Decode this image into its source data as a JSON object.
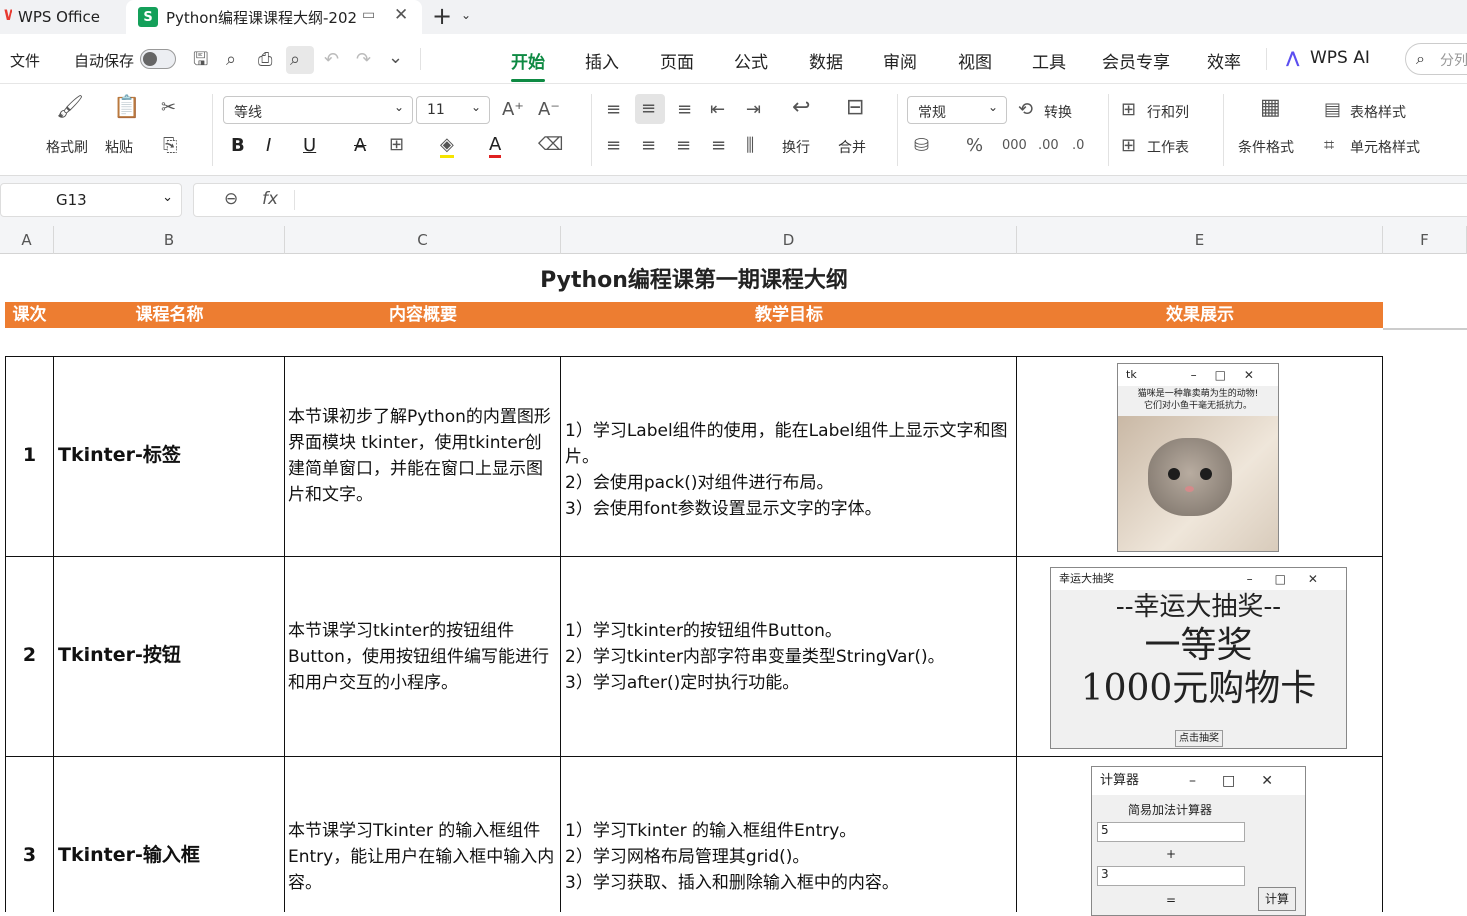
{
  "tabs": {
    "home_label": "WPS Office",
    "doc_label": "Python编程课课程大纲-202",
    "add_glyph": "+"
  },
  "menubar": {
    "file": "文件",
    "autosave": "自动保存",
    "tabs": [
      "开始",
      "插入",
      "页面",
      "公式",
      "数据",
      "审阅",
      "视图",
      "工具",
      "会员专享",
      "效率"
    ],
    "active_tab": "开始",
    "wps_ai": "WPS AI",
    "search_placeholder": "分列"
  },
  "ribbon": {
    "format_painter": "格式刷",
    "paste": "粘贴",
    "font_name": "等线",
    "font_size": "11",
    "wrap": "换行",
    "merge": "合并",
    "number_format": "常规",
    "convert": "转换",
    "row_col": "行和列",
    "worksheet": "工作表",
    "cond_format": "条件格式",
    "table_style": "表格样式",
    "cell_style": "单元格样式"
  },
  "formula_bar": {
    "cell_ref": "G13",
    "fx": "fx",
    "value": ""
  },
  "columns": [
    "A",
    "B",
    "C",
    "D",
    "E",
    "F"
  ],
  "sheet": {
    "title": "Python编程课第一期课程大纲",
    "headers": [
      "课次",
      "课程名称",
      "内容概要",
      "教学目标",
      "效果展示"
    ],
    "rows": [
      {
        "num": "1",
        "name": "Tkinter-标签",
        "summary": "本节课初步了解Python的内置图形界面模块 tkinter，使用tkinter创建简单窗口，并能在窗口上显示图片和文字。",
        "goals": [
          "1）学习Label组件的使用，能在Label组件上显示文字和图片。",
          "2）会使用pack()对组件进行布局。",
          "3）会使用font参数设置显示文字的字体。"
        ]
      },
      {
        "num": "2",
        "name": "Tkinter-按钮",
        "summary": "本节课学习tkinter的按钮组件Button，使用按钮组件编写能进行和用户交互的小程序。",
        "goals": [
          "1）学习tkinter的按钮组件Button。",
          "2）学习tkinter内部字符串变量类型StringVar()。",
          "3）学习after()定时执行功能。"
        ]
      },
      {
        "num": "3",
        "name": "Tkinter-输入框",
        "summary": "本节课学习Tkinter 的输入框组件Entry，能让用户在输入框中输入内容。",
        "goals": [
          "1）学习Tkinter 的输入框组件Entry。",
          "2）学习网格布局管理其grid()。",
          "3）学习获取、插入和删除输入框中的内容。"
        ]
      }
    ]
  },
  "previews": {
    "tk": {
      "title": "tk",
      "line1": "猫咪是一种靠卖萌为生的动物!",
      "line2": "它们对小鱼干毫无抵抗力。"
    },
    "lottery": {
      "title": "幸运大抽奖",
      "heading": "--幸运大抽奖--",
      "prize": "一等奖",
      "card": "1000元购物卡",
      "button": "点击抽奖"
    },
    "calc": {
      "title": "计算器",
      "heading": "简易加法计算器",
      "a": "5",
      "plus": "+",
      "b": "3",
      "eq": "=",
      "button": "计算"
    }
  }
}
